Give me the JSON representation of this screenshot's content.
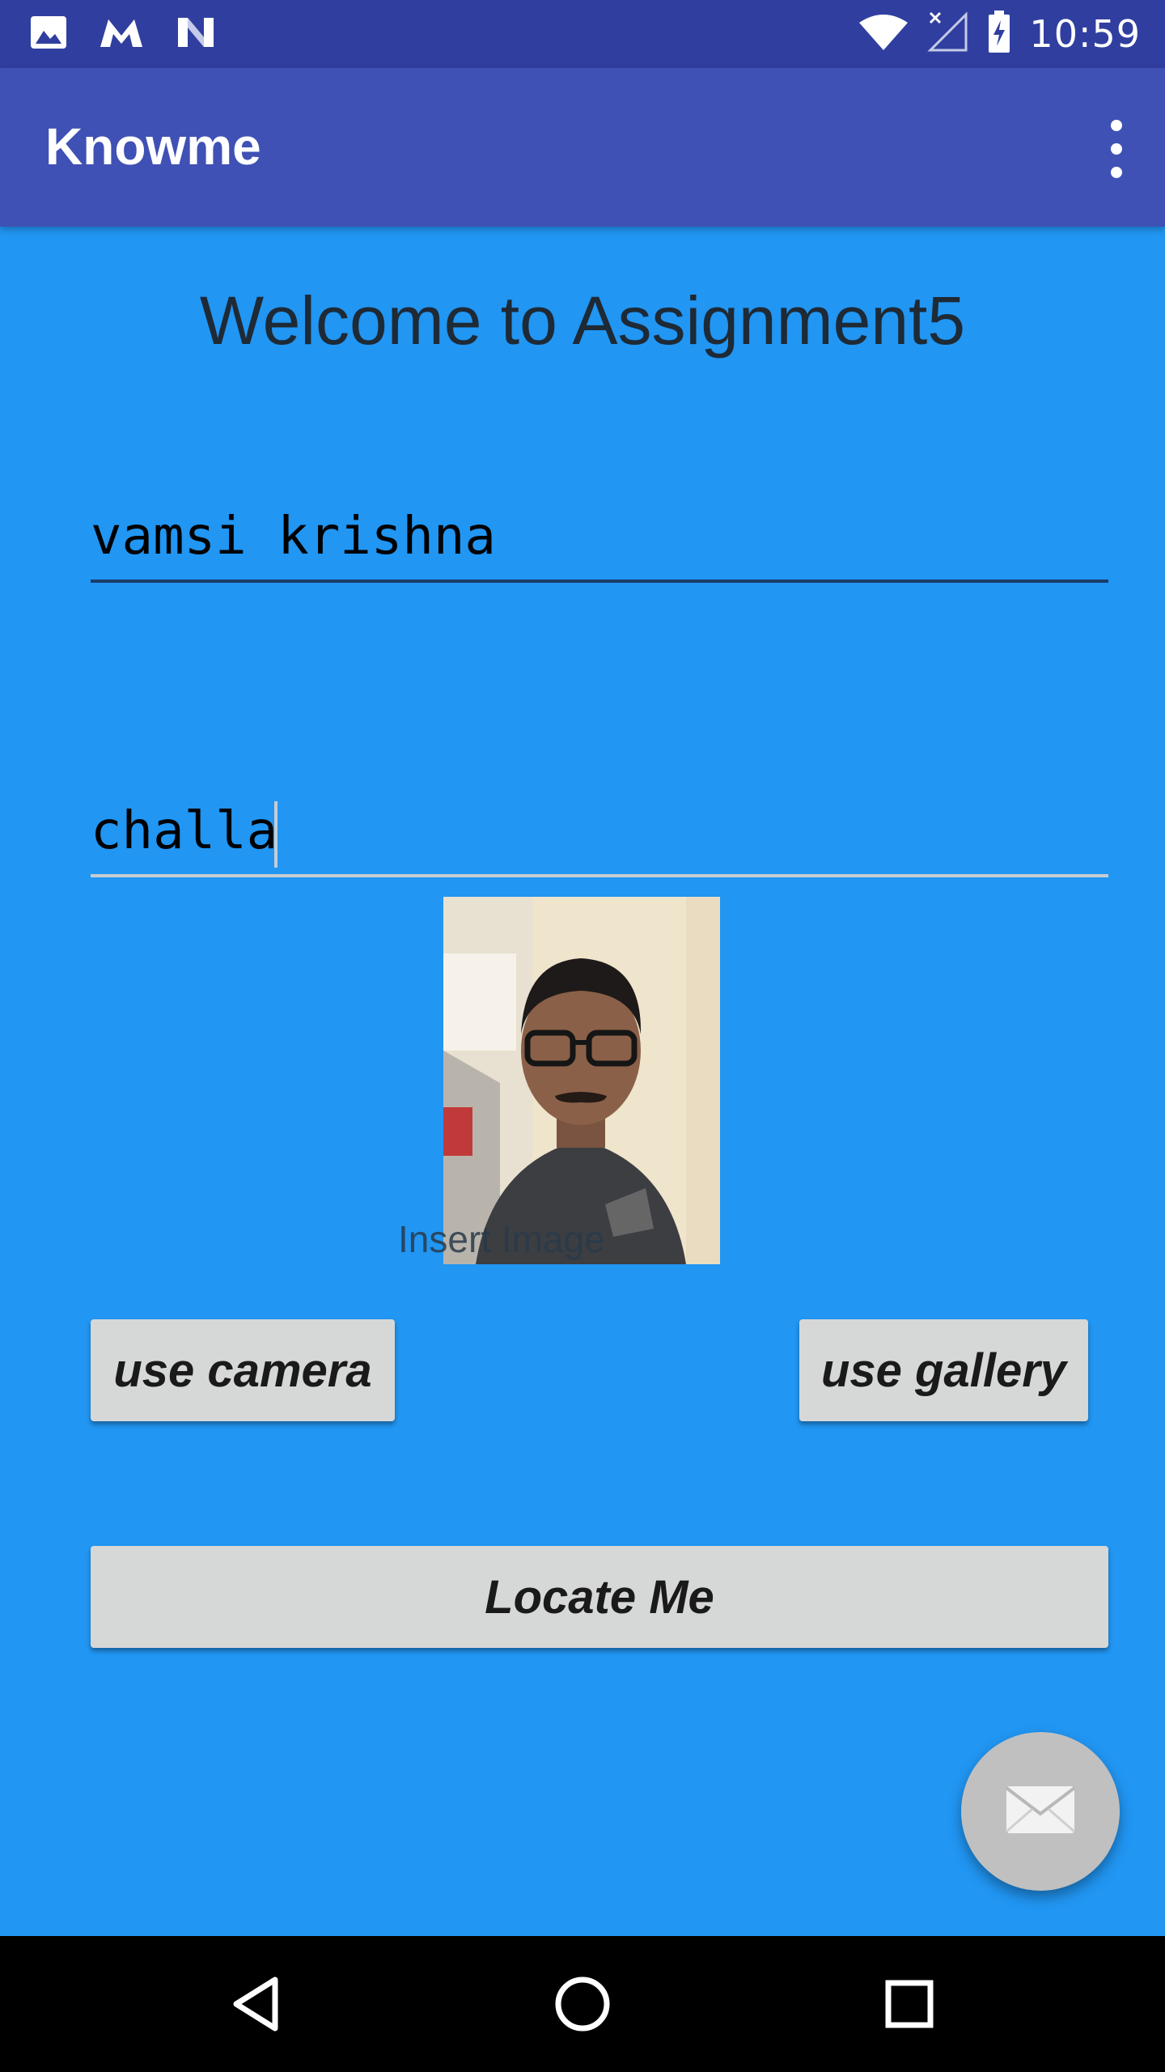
{
  "status_bar": {
    "time": "10:59",
    "left_icons": [
      "image-icon",
      "gmail-icon",
      "n-icon"
    ],
    "right_icons": [
      "wifi-icon",
      "no-signal-icon",
      "battery-charging-icon"
    ]
  },
  "app_bar": {
    "title": "Knowme",
    "menu_icon": "overflow-menu-icon"
  },
  "main": {
    "welcome": "Welcome to Assignment5",
    "first_name_value": "vamsi krishna",
    "last_name_value": "challa",
    "photo_label": "Insert Image",
    "photo_icon": "profile-photo",
    "camera_button": "use camera",
    "gallery_button": "use gallery",
    "locate_button": "Locate Me"
  },
  "fab": {
    "icon": "mail-icon"
  },
  "nav_bar": {
    "back_icon": "back-icon",
    "home_icon": "home-icon",
    "recents_icon": "recents-icon"
  },
  "colors": {
    "status_bar": "#303f9f",
    "app_bar": "#3f51b5",
    "background": "#2196f3",
    "button": "#d6d7d7",
    "fab": "#c0c0c0"
  }
}
